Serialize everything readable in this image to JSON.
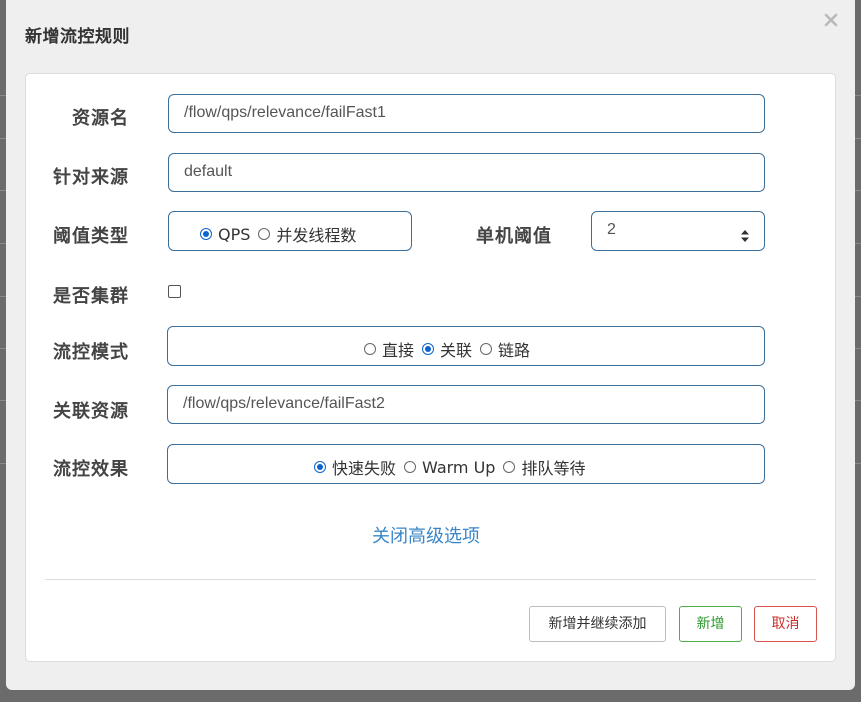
{
  "dialog": {
    "title": "新增流控规则"
  },
  "form": {
    "resource_name": {
      "label": "资源名",
      "value": "/flow/qps/relevance/failFast1"
    },
    "limit_app": {
      "label": "针对来源",
      "value": "default"
    },
    "grade": {
      "label": "阈值类型",
      "options": [
        {
          "label": "QPS",
          "checked": true
        },
        {
          "label": "并发线程数",
          "checked": false
        }
      ]
    },
    "count": {
      "label": "单机阈值",
      "value": "2"
    },
    "cluster": {
      "label": "是否集群",
      "checked": false
    },
    "strategy": {
      "label": "流控模式",
      "options": [
        {
          "label": "直接",
          "checked": false
        },
        {
          "label": "关联",
          "checked": true
        },
        {
          "label": "链路",
          "checked": false
        }
      ]
    },
    "ref_resource": {
      "label": "关联资源",
      "value": "/flow/qps/relevance/failFast2"
    },
    "control_behavior": {
      "label": "流控效果",
      "options": [
        {
          "label": "快速失败",
          "checked": true
        },
        {
          "label": "Warm Up",
          "checked": false
        },
        {
          "label": "排队等待",
          "checked": false
        }
      ]
    },
    "advanced_toggle": "关闭高级选项"
  },
  "footer": {
    "add_continue_label": "新增并继续添加",
    "add_label": "新增",
    "cancel_label": "取消"
  },
  "colors": {
    "accent": "#0b63ce",
    "input_border": "#3a6f9c",
    "link": "#3a86c8",
    "success": "#4cae4c",
    "danger": "#d9534f"
  },
  "icons": {
    "close": "close-icon",
    "spinner": "number-spinner-icon"
  }
}
